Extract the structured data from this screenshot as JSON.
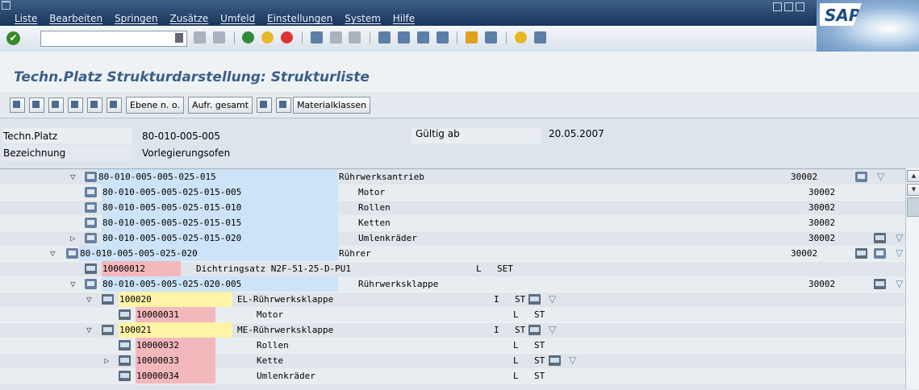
{
  "menubar": {
    "items": [
      "Liste",
      "Bearbeiten",
      "Springen",
      "Zusätze",
      "Umfeld",
      "Einstellungen",
      "System",
      "Hilfe"
    ]
  },
  "logo_text": "SAP",
  "command_field": {
    "value": ""
  },
  "title": "Techn.Platz Strukturdarstellung: Strukturliste",
  "app_toolbar": {
    "ebene": "Ebene n. o.",
    "aufr": "Aufr. gesamt",
    "material": "Materialklassen"
  },
  "header": {
    "techn_label": "Techn.Platz",
    "techn_value": "80-010-005-005",
    "gueltig_label": "Gültig ab",
    "gueltig_value": "20.05.2007",
    "bez_label": "Bezeichnung",
    "bez_value": "Vorlegierungsofen"
  },
  "tree_rows": [
    {
      "twisty": "▽",
      "icon": "fl",
      "id": "80-010-005-005-025-015",
      "desc": "Rührwerksantrieb",
      "code": "30002",
      "hl": "blue",
      "extra_icons": [
        "fl",
        "filter"
      ]
    },
    {
      "twisty": "",
      "icon": "fl",
      "id": "80-010-005-005-025-015-005",
      "desc": "Motor",
      "code": "30002",
      "hl": "blue",
      "extra_icons": []
    },
    {
      "twisty": "",
      "icon": "fl",
      "id": "80-010-005-005-025-015-010",
      "desc": "Rollen",
      "code": "30002",
      "hl": "blue",
      "extra_icons": []
    },
    {
      "twisty": "",
      "icon": "fl",
      "id": "80-010-005-005-025-015-015",
      "desc": "Ketten",
      "code": "30002",
      "hl": "blue",
      "extra_icons": []
    },
    {
      "twisty": "▷",
      "icon": "fl",
      "id": "80-010-005-005-025-015-020",
      "desc": "Umlenkräder",
      "code": "30002",
      "hl": "blue",
      "extra_icons": [
        "eq",
        "filter"
      ]
    },
    {
      "twisty": "▽",
      "icon": "fl",
      "id": "80-010-005-005-025-020",
      "desc": "Rührer",
      "code": "30002",
      "hl": "blue",
      "extra_icons": [
        "eq",
        "fl",
        "filter"
      ]
    },
    {
      "twisty": "",
      "icon": "eq",
      "id": "10000012",
      "desc": "Dichtringsatz N2F-51-25-D-PU1",
      "flag": "L",
      "unit": "SET",
      "hl": "pink",
      "extra_icons": []
    },
    {
      "twisty": "▽",
      "icon": "fl",
      "id": "80-010-005-005-025-020-005",
      "desc": "Rührwerksklappe",
      "code": "30002",
      "hl": "blue",
      "extra_icons": [
        "eq",
        "filter"
      ]
    },
    {
      "twisty": "▽",
      "icon": "eq",
      "id": "100020",
      "desc": "EL-Rührwerksklappe",
      "flag": "I",
      "unit": "ST",
      "hl": "yellow",
      "extra_icons": [
        "eq",
        "filter"
      ]
    },
    {
      "twisty": "",
      "icon": "eq",
      "id": "10000031",
      "desc": "Motor",
      "flag": "L",
      "unit": "ST",
      "hl": "pink",
      "extra_icons": []
    },
    {
      "twisty": "▽",
      "icon": "eq",
      "id": "100021",
      "desc": "ME-Rührwerksklappe",
      "flag": "I",
      "unit": "ST",
      "hl": "yellow",
      "extra_icons": [
        "eq",
        "filter"
      ]
    },
    {
      "twisty": "",
      "icon": "eq",
      "id": "10000032",
      "desc": "Rollen",
      "flag": "L",
      "unit": "ST",
      "hl": "pink",
      "extra_icons": []
    },
    {
      "twisty": "▷",
      "icon": "eq",
      "id": "10000033",
      "desc": "Kette",
      "flag": "L",
      "unit": "ST",
      "hl": "pink",
      "extra_icons": [
        "eq",
        "filter"
      ]
    },
    {
      "twisty": "",
      "icon": "eq",
      "id": "10000034",
      "desc": "Umlenkräder",
      "flag": "L",
      "unit": "ST",
      "hl": "pink",
      "extra_icons": []
    }
  ]
}
